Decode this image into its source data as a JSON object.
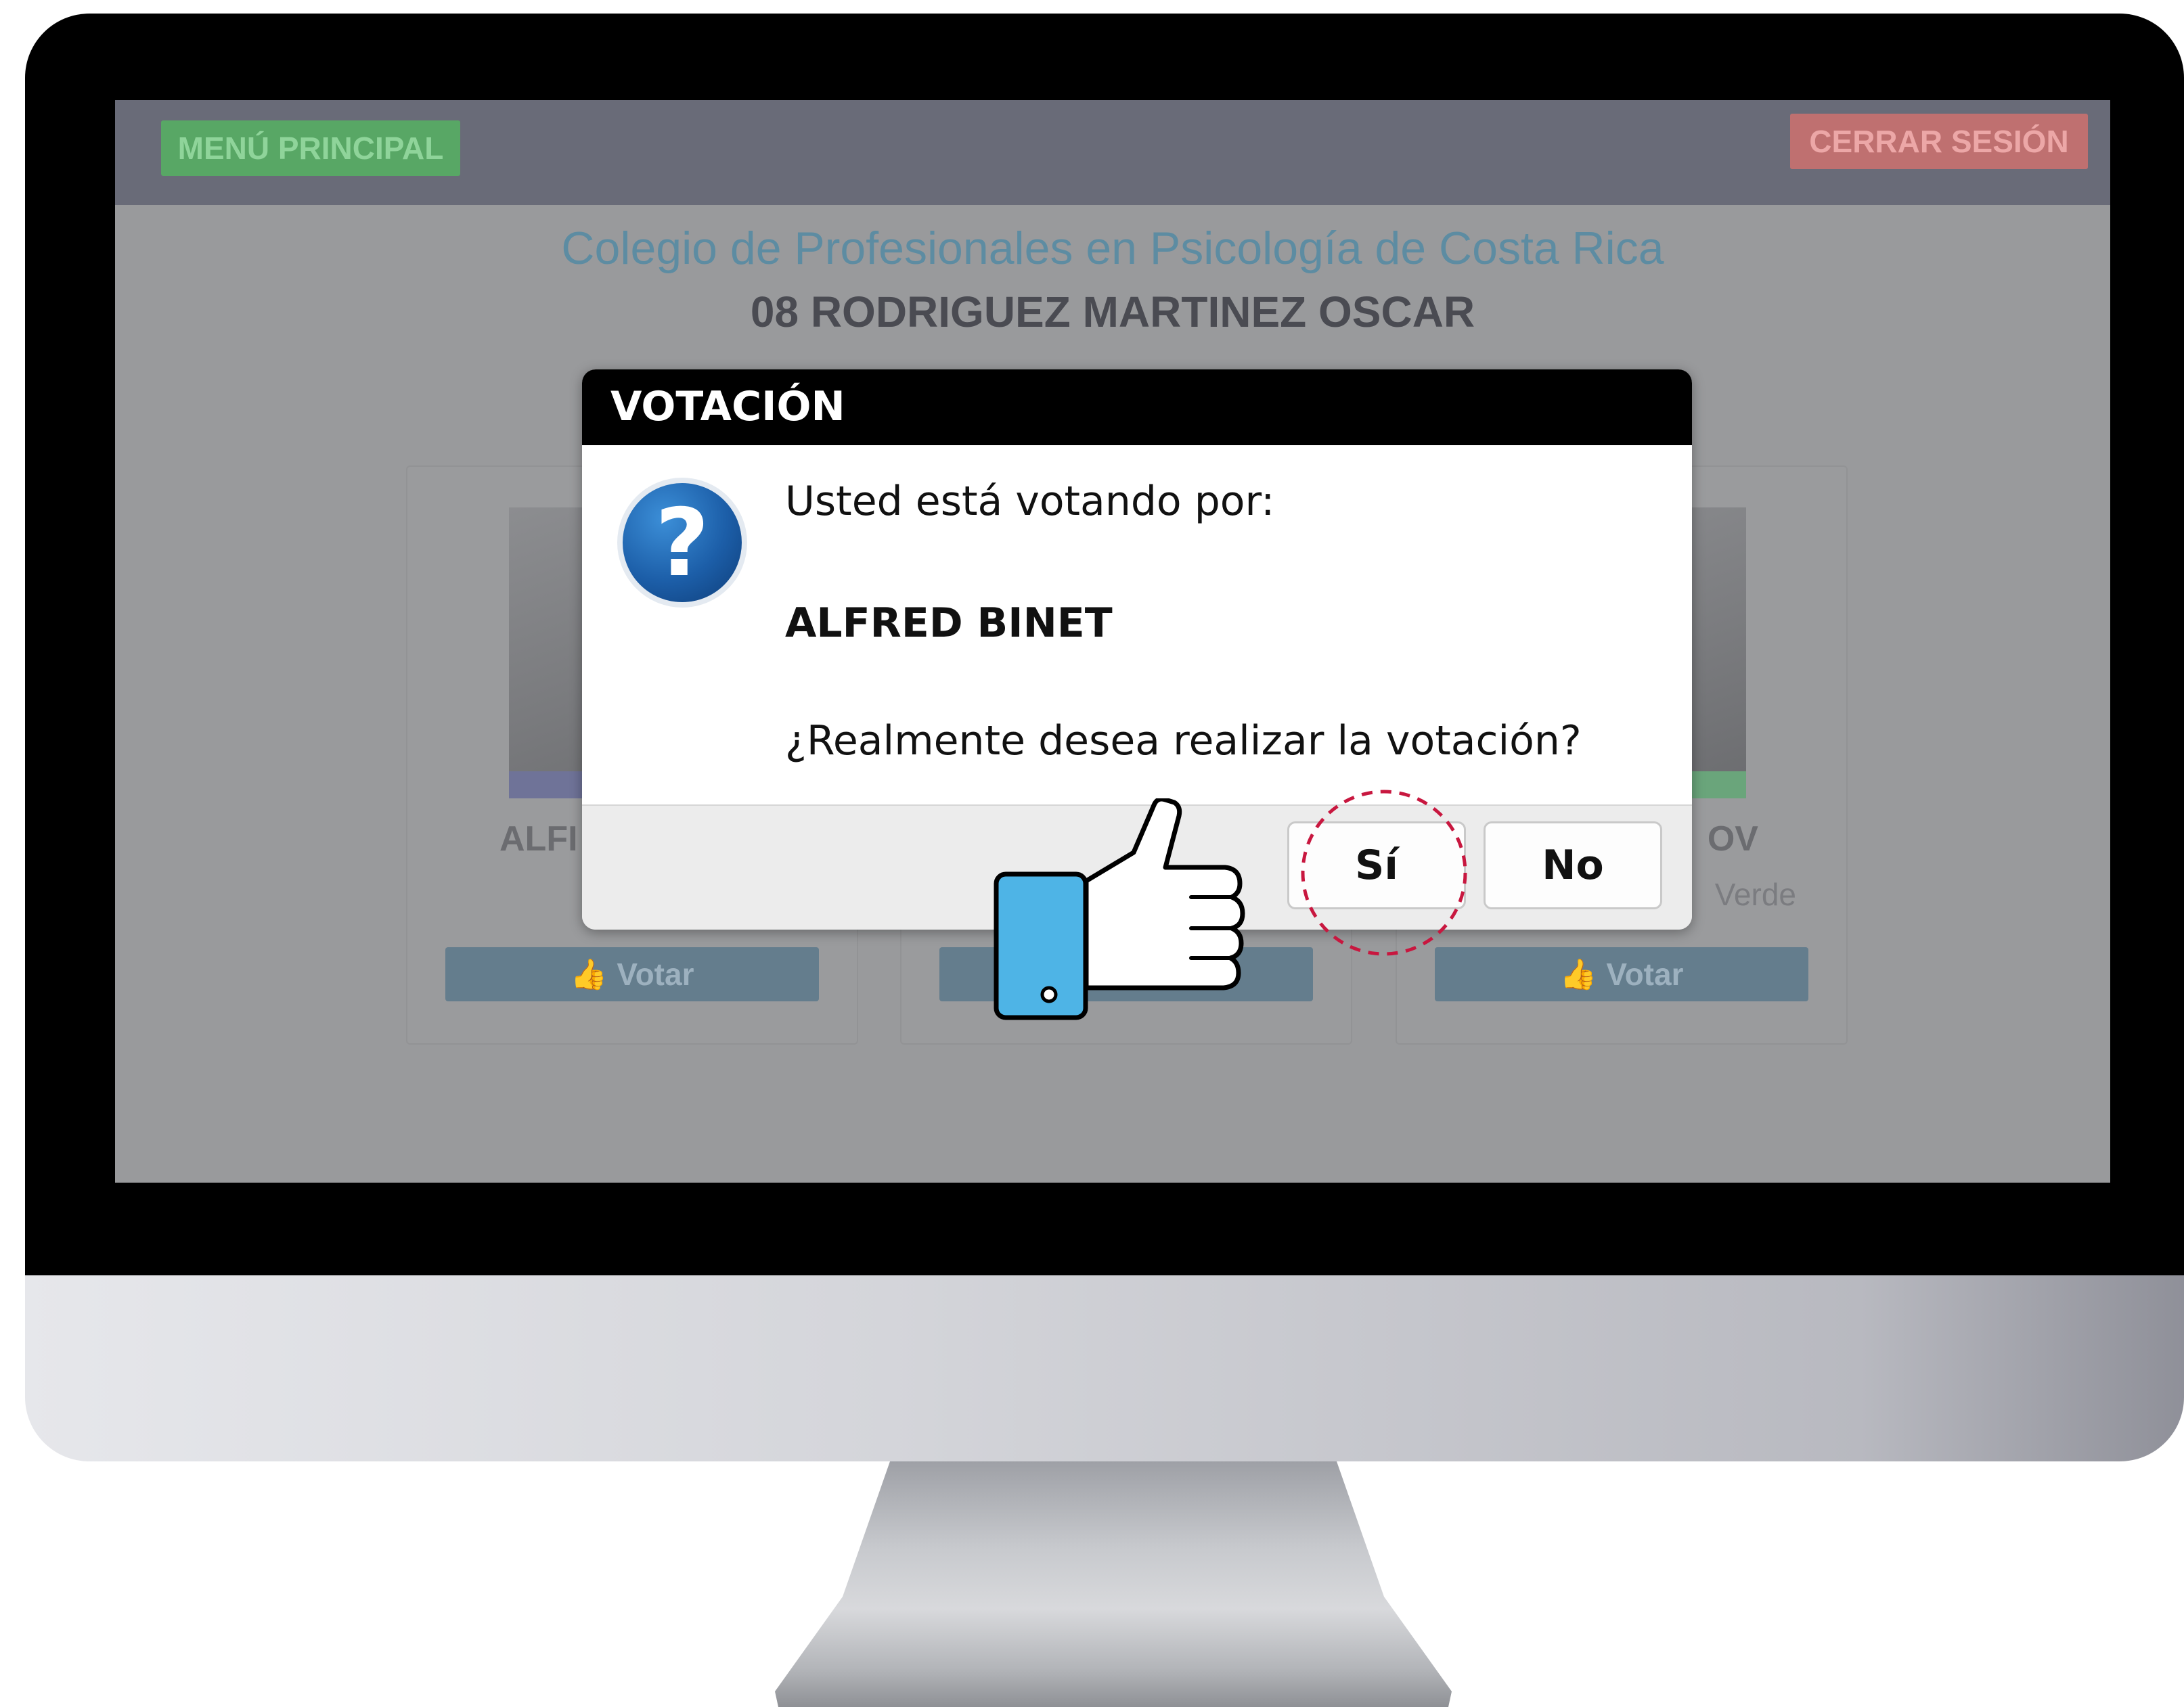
{
  "topbar": {
    "menu_label": "MENÚ PRINCIPAL",
    "logout_label": "CERRAR SESIÓN"
  },
  "header": {
    "organization": "Colegio de Profesionales en Psicología de Costa Rica",
    "voter": "08 RODRIGUEZ MARTINEZ OSCAR"
  },
  "candidates": [
    {
      "name_visible": "ALFI",
      "party_visible": "",
      "vote_label": "Votar"
    },
    {
      "name_visible": "",
      "party_visible": "",
      "vote_label": ""
    },
    {
      "name_visible": "OV",
      "party_visible": "Verde",
      "vote_label": "Votar"
    }
  ],
  "dialog": {
    "title": "VOTACIÓN",
    "icon": "question-icon",
    "line1": "Usted está votando por:",
    "candidate": "ALFRED BINET",
    "question": "¿Realmente desea realizar la votación?",
    "yes_label": "Sí",
    "no_label": "No"
  },
  "colors": {
    "bezel": "#000000",
    "menu_button": "#58a765",
    "logout_button": "#bf7070",
    "vote_button": "#647d8d",
    "dialog_header": "#000000",
    "click_ring": "#c8173f",
    "thumb_cuff": "#4eb4e6"
  }
}
